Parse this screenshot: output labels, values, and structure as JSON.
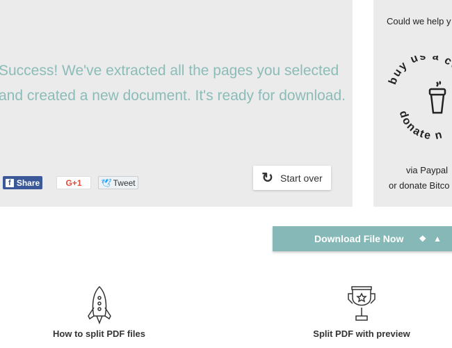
{
  "result": {
    "message": "Success! We've extracted all the pages you selected and created a new document. It's ready for download."
  },
  "social": {
    "facebook": "Share",
    "gplus": "G+1",
    "twitter": "Tweet"
  },
  "actions": {
    "start_over": "Start over",
    "download": "Download File Now"
  },
  "donate": {
    "prompt": "Could we help y",
    "badge_top": "buy us a co",
    "badge_bottom": "donate n",
    "paypal": "via Paypal",
    "bitcoin": "or donate Bitco"
  },
  "features": [
    {
      "label": "How to split PDF files"
    },
    {
      "label": "Split PDF with preview"
    }
  ]
}
